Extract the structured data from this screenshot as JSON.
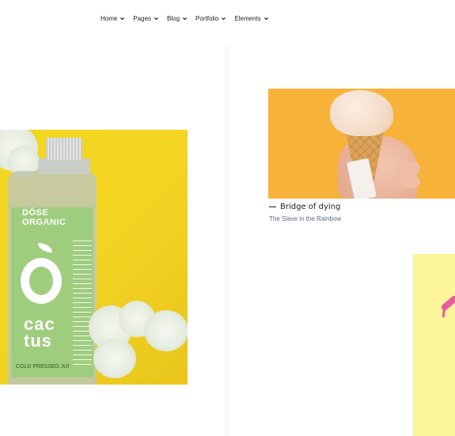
{
  "nav": {
    "items": [
      {
        "label": "Home",
        "icon": "chevron-down-icon"
      },
      {
        "label": "Pages",
        "icon": "chevron-down-icon"
      },
      {
        "label": "Blog",
        "icon": "chevron-down-icon"
      },
      {
        "label": "Portfolio",
        "icon": "chevron-down-icon"
      },
      {
        "label": "Elements",
        "icon": "chevron-down-icon"
      }
    ]
  },
  "product_image": {
    "brand": "DŌSE ORGANIC",
    "name_line1": "cac",
    "name_line2": "tus",
    "pressed": "COLD PRESSED JUI",
    "background_color": "#f2d420",
    "label_color": "#9fcd7e"
  },
  "post": {
    "title": "Bridge of dying",
    "subtitle": "The Slave in the Rainbow",
    "image_background": "#f7b23a"
  },
  "side_card": {
    "background_color": "#fdf59a",
    "accent_color": "#ea5aa0"
  }
}
